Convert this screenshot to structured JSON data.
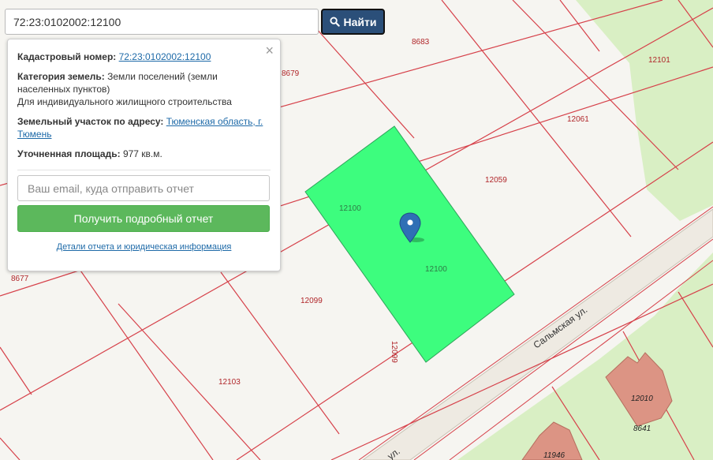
{
  "search": {
    "value": "72:23:0102002:12100",
    "button_label": "Найти",
    "button_icon": "search-icon"
  },
  "popup": {
    "close_glyph": "×",
    "cadastral_label": "Кадастровый номер:",
    "cadastral_value": "72:23:0102002:12100",
    "category_label": "Категория земель:",
    "category_value": "Земли поселений (земли населенных пунктов)",
    "category_use": "Для индивидуального жилищного строительства",
    "address_label": "Земельный участок по адресу:",
    "address_value": "Тюменская область, г. Тюмень",
    "area_label": "Уточненная площадь:",
    "area_value": "977 кв.м.",
    "email_placeholder": "Ваш email, куда отправить отчет",
    "report_button": "Получить подробный отчет",
    "details_link": "Детали отчета и юридическая информация"
  },
  "map": {
    "colors": {
      "background": "#f6f5f1",
      "greenery": "#d9efc4",
      "boundary": "#d6414a",
      "selected_parcel": "#3dfd7e",
      "building": "#dc9484",
      "marker": "#2f6fb5"
    },
    "parcel_labels": [
      "8683",
      "12101",
      "8679",
      "12061",
      "12059",
      "12100",
      "12100",
      "8677",
      "12099",
      "12099",
      "12103",
      "12010",
      "8641",
      "11946"
    ],
    "street_label": "Сальмская ул.",
    "street_label_partial": "ул."
  }
}
